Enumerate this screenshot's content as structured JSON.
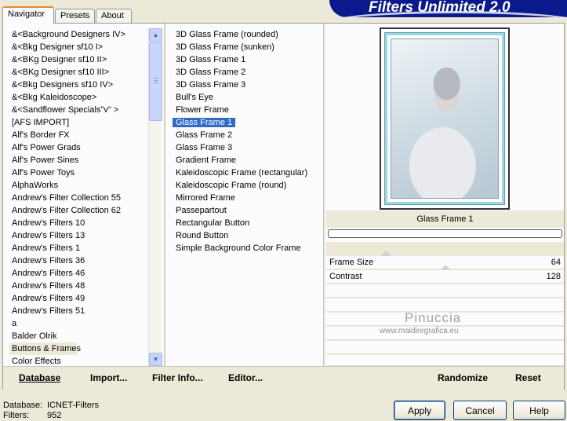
{
  "tabs": [
    {
      "label": "Navigator",
      "active": true
    },
    {
      "label": "Presets",
      "active": false
    },
    {
      "label": "About",
      "active": false
    }
  ],
  "brand": {
    "title": "Filters Unlimited 2.0"
  },
  "categories": {
    "selected": "Buttons & Frames",
    "items": [
      "&<Background Designers IV>",
      "&<Bkg Designer sf10 I>",
      "&<BKg Designer sf10 II>",
      "&<BKg Designer sf10 III>",
      "&<Bkg Designers sf10 IV>",
      "&<Bkg Kaleidoscope>",
      "&<Sandflower Specials\"v\" >",
      "[AFS IMPORT]",
      "Alf's Border FX",
      "Alf's Power Grads",
      "Alf's Power Sines",
      "Alf's Power Toys",
      "AlphaWorks",
      "Andrew's Filter Collection 55",
      "Andrew's Filter Collection 62",
      "Andrew's Filters 10",
      "Andrew's Filters 13",
      "Andrew's Filters 1",
      "Andrew's Filters 36",
      "Andrew's Filters 46",
      "Andrew's Filters 48",
      "Andrew's Filters 49",
      "Andrew's Filters 51",
      "a",
      "Balder Olrik",
      "Buttons & Frames",
      "Color Effects"
    ]
  },
  "filters": {
    "selected": "Glass Frame 1",
    "items": [
      {
        "label": "3D Glass Frame (rounded)",
        "group": false
      },
      {
        "label": "3D Glass Frame (sunken)",
        "group": false
      },
      {
        "label": "3D Glass Frame 1",
        "group": false
      },
      {
        "label": "3D Glass Frame 2",
        "group": false
      },
      {
        "label": "3D Glass Frame 3",
        "group": false
      },
      {
        "label": "Bull's Eye",
        "group": false
      },
      {
        "label": "Flower Frame",
        "group": true
      },
      {
        "label": "Glass Frame 1",
        "group": false
      },
      {
        "label": "Glass Frame 2",
        "group": false
      },
      {
        "label": "Glass Frame 3",
        "group": false
      },
      {
        "label": "Gradient Frame",
        "group": true
      },
      {
        "label": "Kaleidoscopic Frame (rectangular)",
        "group": false
      },
      {
        "label": "Kaleidoscopic Frame (round)",
        "group": false
      },
      {
        "label": "Mirrored Frame",
        "group": false
      },
      {
        "label": "Passepartout",
        "group": true
      },
      {
        "label": "Rectangular Button",
        "group": false
      },
      {
        "label": "Round Button",
        "group": false
      },
      {
        "label": "Simple Background Color Frame",
        "group": false
      }
    ]
  },
  "preview": {
    "filter_title": "Glass Frame 1"
  },
  "params": [
    {
      "name": "Frame Size",
      "value": "64",
      "level": 0.25
    },
    {
      "name": "Contrast",
      "value": "128",
      "level": 0.5
    }
  ],
  "watermark": {
    "title": "Pinuccia",
    "url": "www.maidiregrafica.eu"
  },
  "toolbar": {
    "database": "Database",
    "import": "Import...",
    "filter_info": "Filter Info...",
    "editor": "Editor...",
    "randomize": "Randomize",
    "reset": "Reset"
  },
  "status": {
    "database_label": "Database:",
    "database_value": "ICNET-Filters",
    "filters_label": "Filters:",
    "filters_value": "952"
  },
  "buttons": {
    "apply": "Apply",
    "cancel": "Cancel",
    "help": "Help"
  }
}
